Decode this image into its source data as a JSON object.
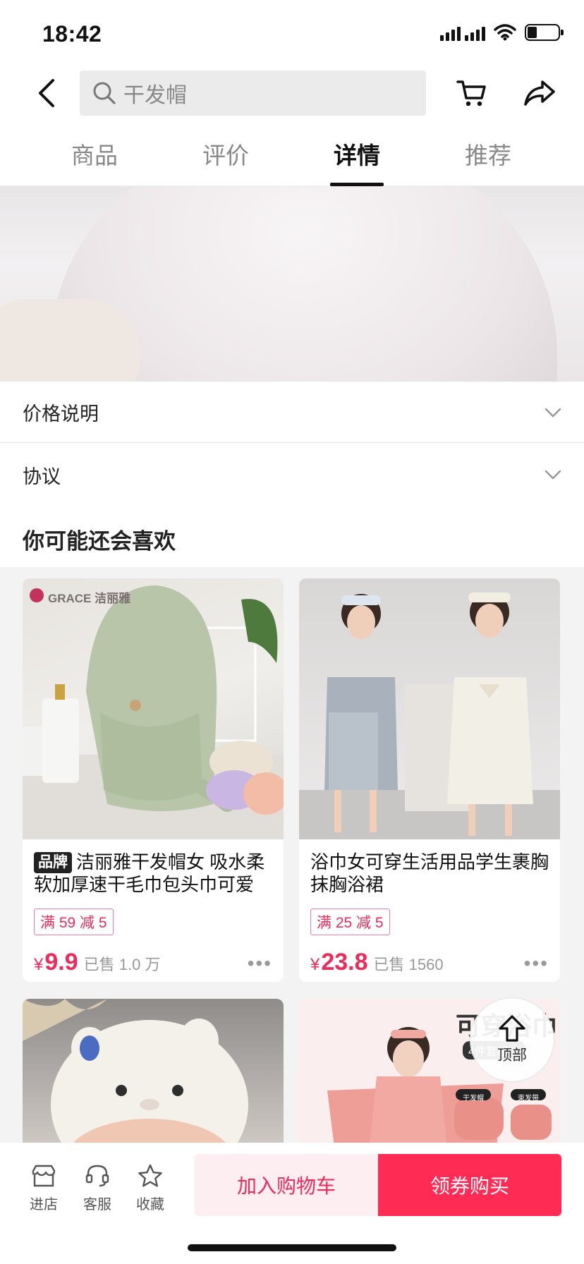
{
  "status_bar": {
    "time": "18:42"
  },
  "header": {
    "search_placeholder": "干发帽"
  },
  "tabs": [
    {
      "label": "商品",
      "active": false
    },
    {
      "label": "评价",
      "active": false
    },
    {
      "label": "详情",
      "active": true
    },
    {
      "label": "推荐",
      "active": false
    }
  ],
  "sections": {
    "price_info": "价格说明",
    "agreement": "协议"
  },
  "recommend": {
    "title": "你可能还会喜欢",
    "products": [
      {
        "brand_badge": "品牌",
        "title": "洁丽雅干发帽女 吸水柔软加厚速干毛巾包头巾可爱",
        "coupon": "满 59 减 5",
        "price_symbol": "¥",
        "price": "9.9",
        "sold": "已售 1.0 万",
        "image_brand_text": "GRACE 洁丽雅"
      },
      {
        "title": "浴巾女可穿生活用品学生裹胸抹胸浴裙",
        "coupon": "满 25 减 5",
        "price_symbol": "¥",
        "price": "23.8",
        "sold": "已售 1560"
      },
      {},
      {
        "image_text": "可穿浴巾",
        "image_sub_text": "4件套组合",
        "tag1": "干发帽",
        "tag2": "束发带"
      }
    ]
  },
  "scroll_top": {
    "label": "顶部"
  },
  "bottom_bar": {
    "shop": "进店",
    "service": "客服",
    "favorite": "收藏",
    "add_to_cart": "加入购物车",
    "buy": "领券购买"
  },
  "colors": {
    "accent": "#fe2c55",
    "price": "#ee2b5a",
    "cart_bg": "#fdeef2"
  }
}
